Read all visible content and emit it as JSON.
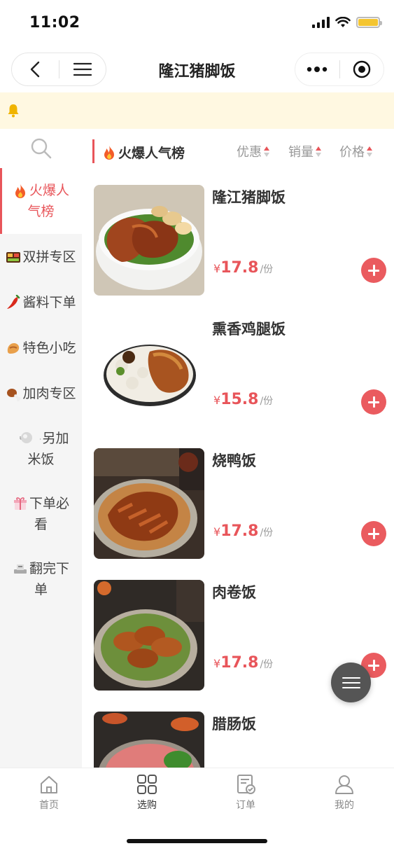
{
  "status_bar": {
    "time": "11:02"
  },
  "nav": {
    "title": "隆江猪脚饭"
  },
  "header": {
    "active_category": "火爆人气榜",
    "sort_options": [
      {
        "label": "优惠"
      },
      {
        "label": "销量"
      },
      {
        "label": "价格"
      }
    ]
  },
  "sidebar": {
    "categories": [
      {
        "label": "火爆人气榜",
        "icon": "fire-icon",
        "active": true
      },
      {
        "label": "双拼专区",
        "icon": "bento-icon"
      },
      {
        "label": "酱料下单",
        "icon": "chili-icon"
      },
      {
        "label": "特色小吃",
        "icon": "snack-icon"
      },
      {
        "label": "加肉专区",
        "icon": "drumstick-icon"
      },
      {
        "label": "另加米饭",
        "icon": "rice-bowl-icon"
      },
      {
        "label": "下单必看",
        "icon": "gift-icon"
      },
      {
        "label": "翻完下单",
        "icon": "tray-icon"
      }
    ]
  },
  "products": [
    {
      "name": "隆江猪脚饭",
      "currency": "¥",
      "price": "17.8",
      "unit": "/份"
    },
    {
      "name": "熏香鸡腿饭",
      "currency": "¥",
      "price": "15.8",
      "unit": "/份"
    },
    {
      "name": "烧鸭饭",
      "currency": "¥",
      "price": "17.8",
      "unit": "/份"
    },
    {
      "name": "肉卷饭",
      "currency": "¥",
      "price": "17.8",
      "unit": "/份"
    },
    {
      "name": "腊肠饭"
    }
  ],
  "tabs": [
    {
      "label": "首页",
      "icon": "home-icon"
    },
    {
      "label": "选购",
      "icon": "grid-icon",
      "active": true
    },
    {
      "label": "订单",
      "icon": "order-icon"
    },
    {
      "label": "我的",
      "icon": "profile-icon"
    }
  ],
  "colors": {
    "accent": "#e8555a",
    "notice_bg": "#fff8e1",
    "battery": "#f4c531"
  }
}
